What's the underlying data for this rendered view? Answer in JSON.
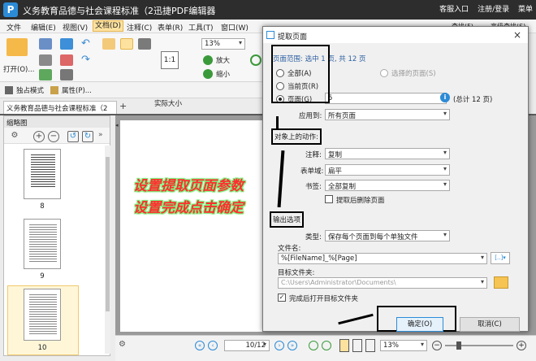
{
  "app": {
    "logo": "P",
    "title": "义务教育品德与社会课程标准（2迅捷PDF编辑器",
    "title_right": [
      "客服入口",
      "注册/登录",
      "菜单"
    ]
  },
  "menu": [
    "文件",
    "编辑(E)",
    "视图(V)",
    "文档(D)",
    "注释(C)",
    "表单(R)",
    "工具(T)",
    "窗口(W)"
  ],
  "ribbon": {
    "open": "打开(O)...",
    "zoom": "13%",
    "actual_size": "实际大小",
    "zoom_in": "放大",
    "zoom_out": "缩小",
    "solo_mode": "独占模式",
    "properties": "属性(P)...",
    "find": "查找(F)",
    "adv_search": "高级查找(S)"
  },
  "tab": {
    "name": "义务教育品德与社会课程标准（2"
  },
  "thumbnails": {
    "header": "缩略图",
    "pages": [
      "8",
      "9",
      "10"
    ]
  },
  "dialog": {
    "title": "提取页面",
    "range_label": "页面范围: 选中 1 页, 共 12 页",
    "opt_all": "全部(A)",
    "opt_current": "当前页(R)",
    "opt_pages": "页面(G)",
    "opt_selected": "选择的页面(S)",
    "pages_value": "5",
    "total": "(总计 12 页)",
    "apply_to_label": "应用到:",
    "apply_to": "所有页面",
    "actions_label": "对象上的动作:",
    "annot_label": "注释:",
    "annot": "复制",
    "forms_label": "表单域:",
    "forms": "扁平",
    "bookmarks_label": "书签:",
    "bookmarks": "全部复制",
    "delete_after": "提取后删除页面",
    "output_label": "输出选项",
    "type_label": "类型:",
    "type": "保存每个页面到每个单独文件",
    "filename_label": "文件名:",
    "filename": "%[FileName]_%[Page]",
    "folder_label": "目标文件夹:",
    "folder": "C:\\Users\\Administrator\\Documents\\",
    "open_folder": "完成后打开目标文件夹",
    "ok": "确定(O)",
    "cancel": "取消(C)"
  },
  "annotation": {
    "line1": "设置提取页面参数",
    "line2": "设置完成点击确定"
  },
  "status": {
    "page": "10/12",
    "zoom": "13%"
  },
  "colors": {
    "accent": "#2c8bd6",
    "annotation_text": "#ff2e2e",
    "annotation_glow": "#7cf07c"
  }
}
